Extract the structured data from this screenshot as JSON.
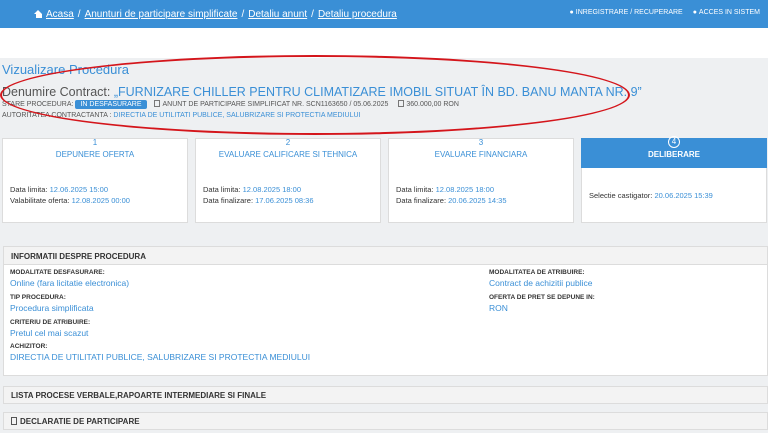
{
  "nav": {
    "breadcrumbs": [
      "Acasa",
      "Anunturi de participare simplificate",
      "Detaliu anunt",
      "Detaliu procedura"
    ],
    "register": "INREGISTRARE / RECUPERARE",
    "login": "ACCES IN SISTEM"
  },
  "page": {
    "title": "Vizualizare Procedura",
    "contract_label": "Denumire Contract:",
    "contract_name": "„FURNIZARE CHILLER PENTRU CLIMATIZARE IMOBIL SITUAT ÎN BD. BANU MANTA NR. 9”",
    "status_label": "STARE PROCEDURA:",
    "status": "IN DESFASURARE",
    "notice": "ANUNT DE PARTICIPARE SIMPLIFICAT NR. SCN1163650 / 05.06.2025",
    "value": "360.000,00",
    "currency": "RON",
    "authority_label": "AUTORITATEA CONTRACTANTA :",
    "authority": "DIRECTIA DE UTILITATI PUBLICE, SALUBRIZARE SI PROTECTIA MEDIULUI"
  },
  "steps": [
    {
      "num": "1",
      "title": "DEPUNERE OFERTA",
      "lines": [
        {
          "label": "Data limita:",
          "value": "12.06.2025 15:00"
        },
        {
          "label": "Valabilitate oferta:",
          "value": "12.08.2025 00:00"
        }
      ]
    },
    {
      "num": "2",
      "title": "EVALUARE CALIFICARE SI TEHNICA",
      "lines": [
        {
          "label": "Data limita:",
          "value": "12.08.2025 18:00"
        },
        {
          "label": "Data finalizare:",
          "value": "17.06.2025 08:36"
        }
      ]
    },
    {
      "num": "3",
      "title": "EVALUARE FINANCIARA",
      "lines": [
        {
          "label": "Data limita:",
          "value": "12.08.2025 18:00"
        },
        {
          "label": "Data finalizare:",
          "value": "20.06.2025 14:35"
        }
      ]
    },
    {
      "num": "4",
      "title": "DELIBERARE",
      "lines": [
        {
          "label": "Selectie castigator:",
          "value": "20.06.2025 15:39"
        }
      ]
    }
  ],
  "info": {
    "header": "INFORMATII DESPRE PROCEDURA",
    "modalitate_label": "MODALITATE DESFASURARE:",
    "modalitate": "Online (fara licitatie electronica)",
    "tip_label": "TIP PROCEDURA:",
    "tip": "Procedura simplificata",
    "criteriu_label": "CRITERIU DE ATRIBUIRE:",
    "criteriu": "Pretul cel mai scazut",
    "achizitor_label": "ACHIZITOR:",
    "achizitor": "DIRECTIA DE UTILITATI PUBLICE, SALUBRIZARE SI PROTECTIA MEDIULUI",
    "atribuire_label": "MODALITATEA DE ATRIBUIRE:",
    "atribuire": "Contract de achizitii publice",
    "oferta_label": "OFERTA DE PRET SE DEPUNE IN:",
    "oferta": "RON"
  },
  "panels": {
    "procese": "LISTA PROCESE VERBALE,RAPOARTE INTERMEDIARE SI FINALE",
    "declaratie": "DECLARATIE DE PARTICIPARE"
  }
}
